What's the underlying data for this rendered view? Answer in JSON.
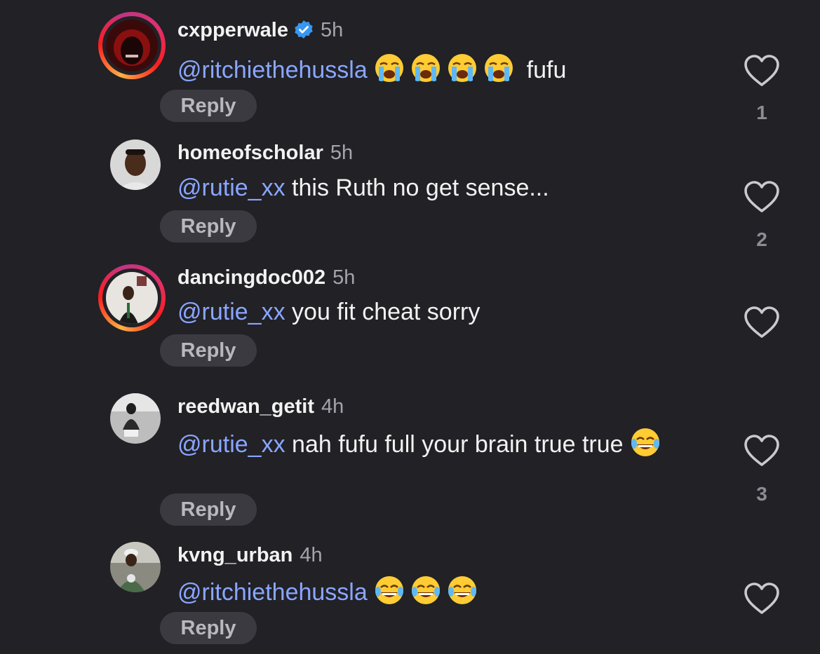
{
  "colors": {
    "background": "#212126",
    "mention": "#8aa6ff",
    "reply_bg": "#3a3a40",
    "verified": "#3897f0"
  },
  "reply_label": "Reply",
  "comments": [
    {
      "username": "cxpperwale",
      "verified": true,
      "time": "5h",
      "mention": "@ritchiethehussla",
      "text": "fufu",
      "emojis": [
        "loudly-crying-face",
        "loudly-crying-face",
        "loudly-crying-face",
        "loudly-crying-face"
      ],
      "likes": "1",
      "story_ring": true
    },
    {
      "username": "homeofscholar",
      "verified": false,
      "time": "5h",
      "mention": "@rutie_xx",
      "text": "this Ruth no get sense...",
      "likes": "2",
      "story_ring": false
    },
    {
      "username": "dancingdoc002",
      "verified": false,
      "time": "5h",
      "mention": "@rutie_xx",
      "text": "you fit cheat sorry",
      "likes": "",
      "story_ring": true
    },
    {
      "username": "reedwan_getit",
      "verified": false,
      "time": "4h",
      "mention": "@rutie_xx",
      "text": "nah fufu full your brain true true",
      "emojis": [
        "face-with-tears-of-joy"
      ],
      "likes": "3",
      "story_ring": false
    },
    {
      "username": "kvng_urban",
      "verified": false,
      "time": "4h",
      "mention": "@ritchiethehussla",
      "text": "",
      "emojis": [
        "face-with-tears-of-joy",
        "face-with-tears-of-joy",
        "face-with-tears-of-joy"
      ],
      "likes": "",
      "story_ring": false
    }
  ]
}
